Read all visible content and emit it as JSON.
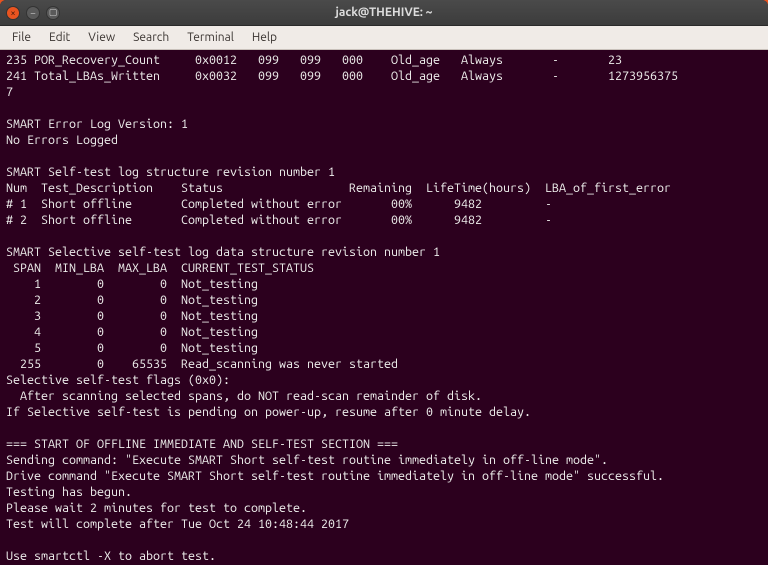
{
  "window": {
    "title": "jack@THEHIVE: ~",
    "buttons": {
      "close": "×",
      "min": "–",
      "max": "▢"
    }
  },
  "menubar": {
    "items": [
      "File",
      "Edit",
      "View",
      "Search",
      "Terminal",
      "Help"
    ]
  },
  "terminal_text": "235 POR_Recovery_Count     0x0012   099   099   000    Old_age   Always       -       23\n241 Total_LBAs_Written     0x0032   099   099   000    Old_age   Always       -       1273956375\n7\n\nSMART Error Log Version: 1\nNo Errors Logged\n\nSMART Self-test log structure revision number 1\nNum  Test_Description    Status                  Remaining  LifeTime(hours)  LBA_of_first_error\n# 1  Short offline       Completed without error       00%      9482         -\n# 2  Short offline       Completed without error       00%      9482         -\n\nSMART Selective self-test log data structure revision number 1\n SPAN  MIN_LBA  MAX_LBA  CURRENT_TEST_STATUS\n    1        0        0  Not_testing\n    2        0        0  Not_testing\n    3        0        0  Not_testing\n    4        0        0  Not_testing\n    5        0        0  Not_testing\n  255        0    65535  Read_scanning was never started\nSelective self-test flags (0x0):\n  After scanning selected spans, do NOT read-scan remainder of disk.\nIf Selective self-test is pending on power-up, resume after 0 minute delay.\n\n=== START OF OFFLINE IMMEDIATE AND SELF-TEST SECTION ===\nSending command: \"Execute SMART Short self-test routine immediately in off-line mode\".\nDrive command \"Execute SMART Short self-test routine immediately in off-line mode\" successful.\nTesting has begun.\nPlease wait 2 minutes for test to complete.\nTest will complete after Tue Oct 24 10:48:44 2017\n\nUse smartctl -X to abort test."
}
